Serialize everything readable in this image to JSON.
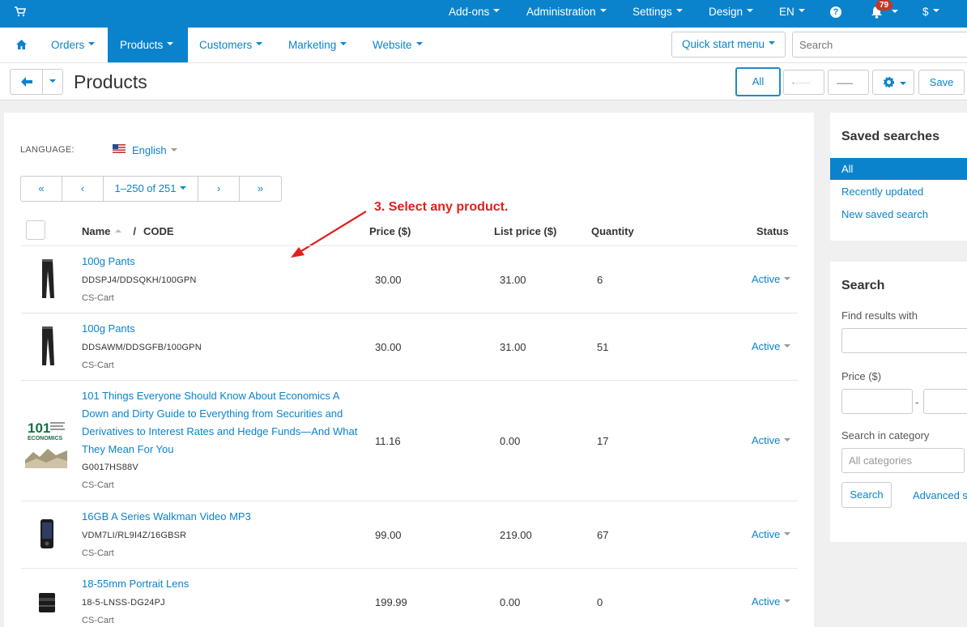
{
  "topbar": {
    "menus": [
      "Add-ons",
      "Administration",
      "Settings",
      "Design",
      "EN"
    ],
    "help_label": "?",
    "notifications_count": "79",
    "currency": "$"
  },
  "nav": {
    "items": [
      "Orders",
      "Products",
      "Customers",
      "Marketing",
      "Website"
    ],
    "active": "Products",
    "quick_start": "Quick start menu",
    "search_placeholder": "Search"
  },
  "titlebar": {
    "title": "Products",
    "all_label": "All",
    "save_label": "Save"
  },
  "filters": {
    "language_label": "LANGUAGE:",
    "language_value": "English"
  },
  "pager": {
    "first": "«",
    "prev": "‹",
    "range": "1–250 of 251",
    "next": "›",
    "last": "»"
  },
  "annotation": "3. Select any product.",
  "table": {
    "headers": {
      "name": "Name",
      "separator": "/",
      "code": "CODE",
      "price": "Price ($)",
      "list_price": "List price ($)",
      "quantity": "Quantity",
      "status": "Status"
    },
    "rows": [
      {
        "name": "100g Pants",
        "code": "DDSPJ4/DDSQKH/100GPN",
        "vendor": "CS-Cart",
        "price": "30.00",
        "list_price": "31.00",
        "quantity": "6",
        "status": "Active",
        "thumb": "pants"
      },
      {
        "name": "100g Pants",
        "code": "DDSAWM/DDSGFB/100GPN",
        "vendor": "CS-Cart",
        "price": "30.00",
        "list_price": "31.00",
        "quantity": "51",
        "status": "Active",
        "thumb": "pants"
      },
      {
        "name": "101 Things Everyone Should Know About Economics A Down and Dirty Guide to Everything from Securities and Derivatives to Interest Rates and Hedge Funds—And What They Mean For You",
        "code": "G0017HS88V",
        "vendor": "CS-Cart",
        "price": "11.16",
        "list_price": "0.00",
        "quantity": "17",
        "status": "Active",
        "thumb": "book",
        "thumb_text_1": "101",
        "thumb_text_2": "ECONOMICS"
      },
      {
        "name": "16GB A Series Walkman Video MP3",
        "code": "VDM7LI/RL9I4Z/16GBSR",
        "vendor": "CS-Cart",
        "price": "99.00",
        "list_price": "219.00",
        "quantity": "67",
        "status": "Active",
        "thumb": "player"
      },
      {
        "name": "18-55mm Portrait Lens",
        "code": "18-5-LNSS-DG24PJ",
        "vendor": "CS-Cart",
        "price": "199.99",
        "list_price": "0.00",
        "quantity": "0",
        "status": "Active",
        "thumb": "lens"
      }
    ]
  },
  "saved_searches": {
    "title": "Saved searches",
    "items": [
      "All",
      "Recently updated",
      "New saved search"
    ]
  },
  "search_panel": {
    "title": "Search",
    "find_label": "Find results with",
    "price_label": "Price ($)",
    "price_separator": "-",
    "category_label": "Search in category",
    "category_value": "All categories",
    "search_button": "Search",
    "advanced_link": "Advanced s"
  },
  "colors": {
    "primary": "#0b83cc",
    "annotation": "#e02020",
    "badge": "#c0392b"
  }
}
